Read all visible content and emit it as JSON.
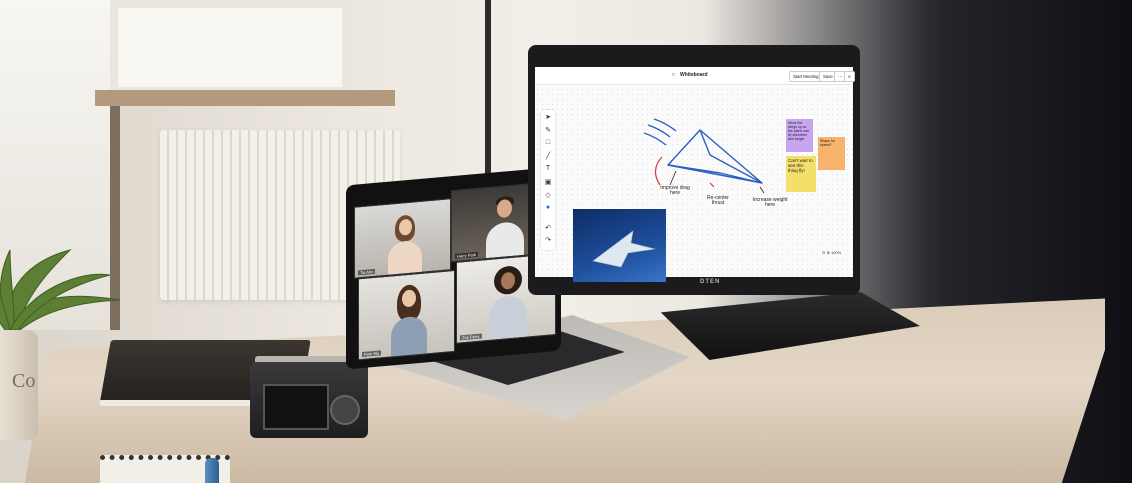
{
  "whiteboard": {
    "title": "Whiteboard",
    "buttons": [
      "Start Meeting",
      "Save",
      "⋯",
      "≡"
    ],
    "zoom_label": "100%",
    "annotations": [
      "Improve drag here",
      "Re-center thrust",
      "Increase weight here"
    ],
    "sticky_notes": [
      {
        "text": "Move the wings up so the plane can fly smoother and longer",
        "color": "#c8a5f0"
      },
      {
        "text": "Shape for speed?",
        "color": "#f7b26b"
      },
      {
        "text": "Can't wait to see this thing fly!",
        "color": "#f3df6a"
      }
    ],
    "tools": [
      "select-icon",
      "pen-icon",
      "rectangle-icon",
      "line-icon",
      "text-icon",
      "sticky-icon",
      "shape-icon",
      "color-dot-icon",
      "undo-icon",
      "redo-icon"
    ]
  },
  "monitor_brand": "DTEN",
  "video_call": {
    "participants": [
      "Tia Ann",
      "Harry Park",
      "Pam Wu",
      "Zoe Perry"
    ]
  },
  "pot_text": "Co"
}
